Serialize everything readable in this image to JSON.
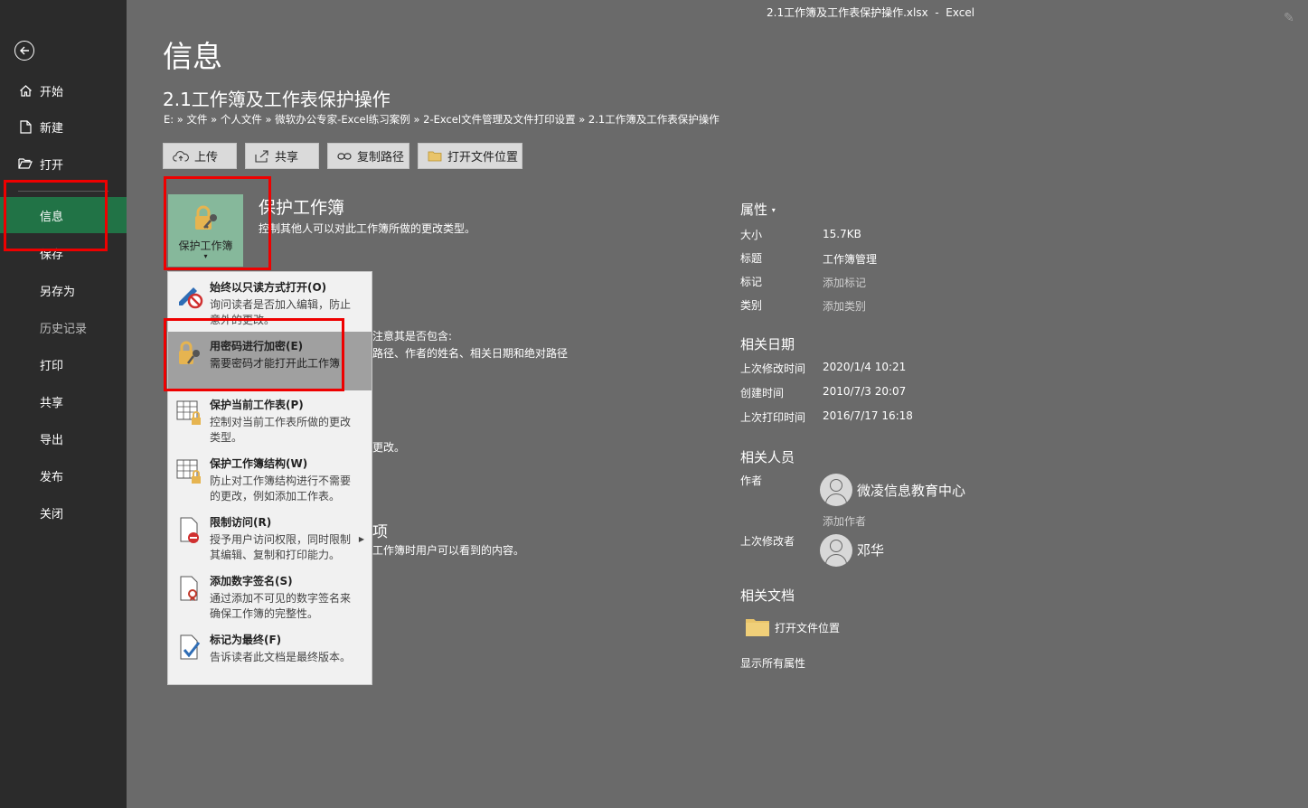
{
  "window": {
    "title": "2.1工作簿及工作表保护操作.xlsx  -  Excel"
  },
  "sidebar": {
    "items": [
      {
        "label": "开始",
        "icon": "home-icon"
      },
      {
        "label": "新建",
        "icon": "new-document-icon"
      },
      {
        "label": "打开",
        "icon": "open-folder-icon"
      },
      {
        "label": "信息"
      },
      {
        "label": "保存"
      },
      {
        "label": "另存为"
      },
      {
        "label": "历史记录"
      },
      {
        "label": "打印"
      },
      {
        "label": "共享"
      },
      {
        "label": "导出"
      },
      {
        "label": "发布"
      },
      {
        "label": "关闭"
      }
    ]
  },
  "main": {
    "page_title": "信息",
    "doc_title": "2.1工作簿及工作表保护操作",
    "breadcrumb": "E: » 文件 » 个人文件 » 微软办公专家-Excel练习案例 » 2-Excel文件管理及文件打印设置 » 2.1工作簿及工作表保护操作",
    "buttons": {
      "upload": "上传",
      "share": "共享",
      "copy_path": "复制路径",
      "open_location": "打开文件位置"
    },
    "protect": {
      "tile_label": "保护工作簿",
      "heading": "保护工作簿",
      "desc": "控制其他人可以对此工作簿所做的更改类型。"
    },
    "hidden_fragments": {
      "inspect_line1": "注意其是否包含:",
      "inspect_line2": "路径、作者的姓名、相关日期和绝对路径",
      "manage_line": "更改。",
      "browser_heading": "项",
      "browser_desc": "工作簿时用户可以看到的内容。"
    }
  },
  "protect_menu": {
    "items": [
      {
        "title": "始终以只读方式打开(O)",
        "desc": "询问读者是否加入编辑，防止意外的更改。"
      },
      {
        "title": "用密码进行加密(E)",
        "desc": "需要密码才能打开此工作簿"
      },
      {
        "title": "保护当前工作表(P)",
        "desc": "控制对当前工作表所做的更改类型。"
      },
      {
        "title": "保护工作簿结构(W)",
        "desc": "防止对工作簿结构进行不需要的更改，例如添加工作表。"
      },
      {
        "title": "限制访问(R)",
        "desc": "授予用户访问权限，同时限制其编辑、复制和打印能力。"
      },
      {
        "title": "添加数字签名(S)",
        "desc": "通过添加不可见的数字签名来确保工作簿的完整性。"
      },
      {
        "title": "标记为最终(F)",
        "desc": "告诉读者此文档是最终版本。"
      }
    ]
  },
  "properties": {
    "heading": "属性",
    "rows": [
      {
        "label": "大小",
        "value": "15.7KB"
      },
      {
        "label": "标题",
        "value": "工作簿管理"
      },
      {
        "label": "标记",
        "value": "添加标记"
      },
      {
        "label": "类别",
        "value": "添加类别"
      }
    ],
    "dates_heading": "相关日期",
    "dates": [
      {
        "label": "上次修改时间",
        "value": "2020/1/4 10:21"
      },
      {
        "label": "创建时间",
        "value": "2010/7/3 20:07"
      },
      {
        "label": "上次打印时间",
        "value": "2016/7/17 16:18"
      }
    ],
    "people_heading": "相关人员",
    "author_label": "作者",
    "author_name": "微凌信息教育中心",
    "add_author": "添加作者",
    "last_modified_by_label": "上次修改者",
    "last_modified_by": "邓华",
    "docs_heading": "相关文档",
    "open_location": "打开文件位置",
    "show_all": "显示所有属性"
  },
  "colors": {
    "sidebar_bg": "#2b2b2b",
    "active_green": "#217346",
    "main_bg": "#6a6a6a",
    "highlight_red": "#e00000"
  }
}
